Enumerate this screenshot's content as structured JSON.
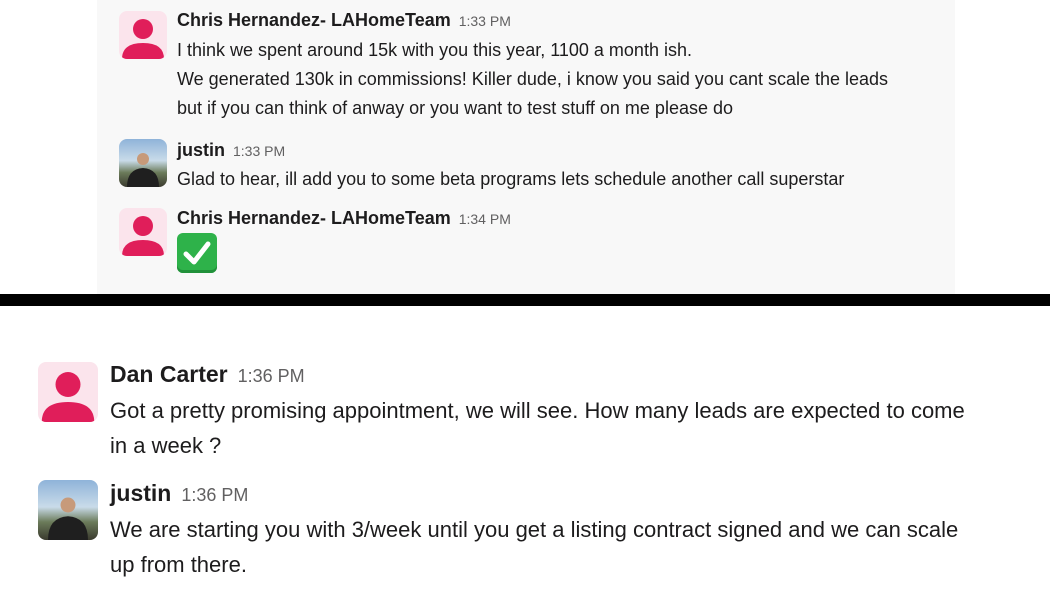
{
  "top_panel": {
    "messages": [
      {
        "author": "Chris Hernandez- LAHomeTeam",
        "time": "1:33 PM",
        "lines": [
          "I think we spent around 15k with you this year, 1100 a month ish.",
          "We generated 130k in commissions! Killer dude, i know you said you cant scale the leads",
          "but if you can think of anway or you want to test stuff on me please do"
        ],
        "avatar": "default-user-icon"
      },
      {
        "author": "justin",
        "time": "1:33 PM",
        "lines": [
          "Glad to hear, ill add you to some beta programs lets schedule another call superstar"
        ],
        "avatar": "photo"
      },
      {
        "author": "Chris Hernandez- LAHomeTeam",
        "time": "1:34 PM",
        "lines": [],
        "emoji": "white-check-mark-icon",
        "avatar": "default-user-icon"
      }
    ]
  },
  "bottom_panel": {
    "messages": [
      {
        "author": "Dan Carter",
        "time": "1:36 PM",
        "lines": [
          "Got a pretty promising appointment, we will see. How many leads are expected to come",
          "in a week ?"
        ],
        "avatar": "default-user-icon"
      },
      {
        "author": "justin",
        "time": "1:36 PM",
        "lines": [
          "We are starting you with 3/week until you get a listing contract signed and we can scale",
          "up from there."
        ],
        "avatar": "photo"
      }
    ]
  },
  "colors": {
    "default_avatar_bg": "#fbe4ec",
    "default_avatar_fg": "#e01e5a",
    "check_bg": "#2eb24a",
    "divider": "#000000"
  }
}
